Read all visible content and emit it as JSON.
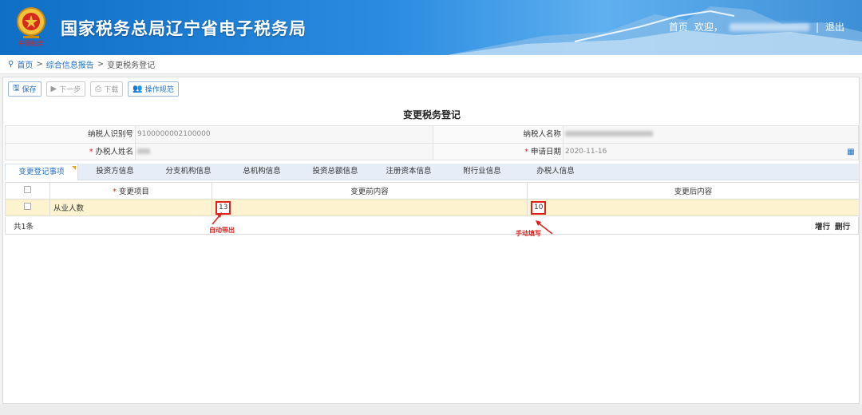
{
  "header": {
    "title": "国家税务总局辽宁省电子税务局",
    "emblem_caption": "中国税务",
    "home_link": "首页",
    "welcome": "欢迎，",
    "separator": "|",
    "logout": "退出"
  },
  "breadcrumb": {
    "items": [
      "首页",
      "综合信息报告",
      "变更税务登记"
    ],
    "separator": ">"
  },
  "toolbar": {
    "save": "保存",
    "next": "下一步",
    "download": "下载",
    "guide": "操作规范"
  },
  "form": {
    "title": "变更税务登记",
    "taxpayer_id_label": "纳税人识别号",
    "taxpayer_id_value": "9100000002100000",
    "taxpayer_name_label": "纳税人名称",
    "agent_name_label": "办税人姓名",
    "apply_date_label": "申请日期",
    "apply_date_value": "2020-11-16"
  },
  "tabs": [
    "变更登记事项",
    "投资方信息",
    "分支机构信息",
    "总机构信息",
    "投资总额信息",
    "注册资本信息",
    "附行业信息",
    "办税人信息"
  ],
  "grid": {
    "headers": [
      "变更项目",
      "变更前内容",
      "变更后内容"
    ],
    "rows": [
      {
        "item": "从业人数",
        "before": "13",
        "after": "10"
      }
    ],
    "count": "共1条",
    "add_row": "增行",
    "delete_row": "删行"
  },
  "annotations": {
    "auto": "自动带出",
    "manual": "手动填写"
  },
  "colors": {
    "accent": "#1f6fc5",
    "highlight": "#e0201b",
    "selected_row": "#fdf3cf"
  }
}
